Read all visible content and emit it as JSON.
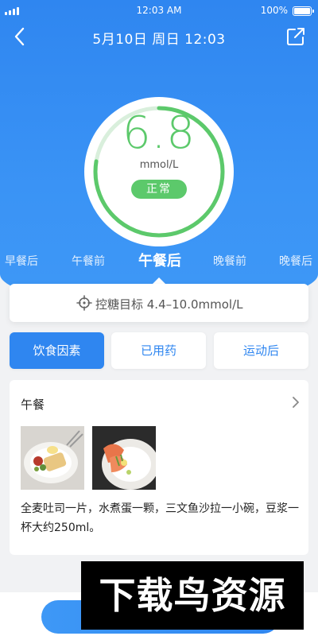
{
  "status_bar": {
    "time": "12:03 AM",
    "battery": "100%"
  },
  "nav": {
    "title": "5月10日 周日 12:03"
  },
  "gauge": {
    "value": "6.8",
    "unit": "mmol/L",
    "status": "正常"
  },
  "meal_tabs": [
    "早餐后",
    "午餐前",
    "午餐后",
    "晚餐前",
    "晚餐后"
  ],
  "active_meal_tab": "午餐后",
  "target": {
    "text": "控糖目标 4.4–10.0mmol/L"
  },
  "factors": {
    "diet": "饮食因素",
    "medicine": "已用药",
    "exercise": "运动后"
  },
  "meal": {
    "title": "午餐",
    "description": "全麦吐司一片，水煮蛋一颗，三文鱼沙拉一小碗，豆浆一杯大约250ml。"
  },
  "watermark": "下载鸟资源",
  "colors": {
    "primary": "#2f86f0",
    "normal_green": "#5cc96b"
  },
  "icons": [
    "back-arrow-icon",
    "share-icon",
    "target-crosshair-icon",
    "chevron-right-icon"
  ]
}
